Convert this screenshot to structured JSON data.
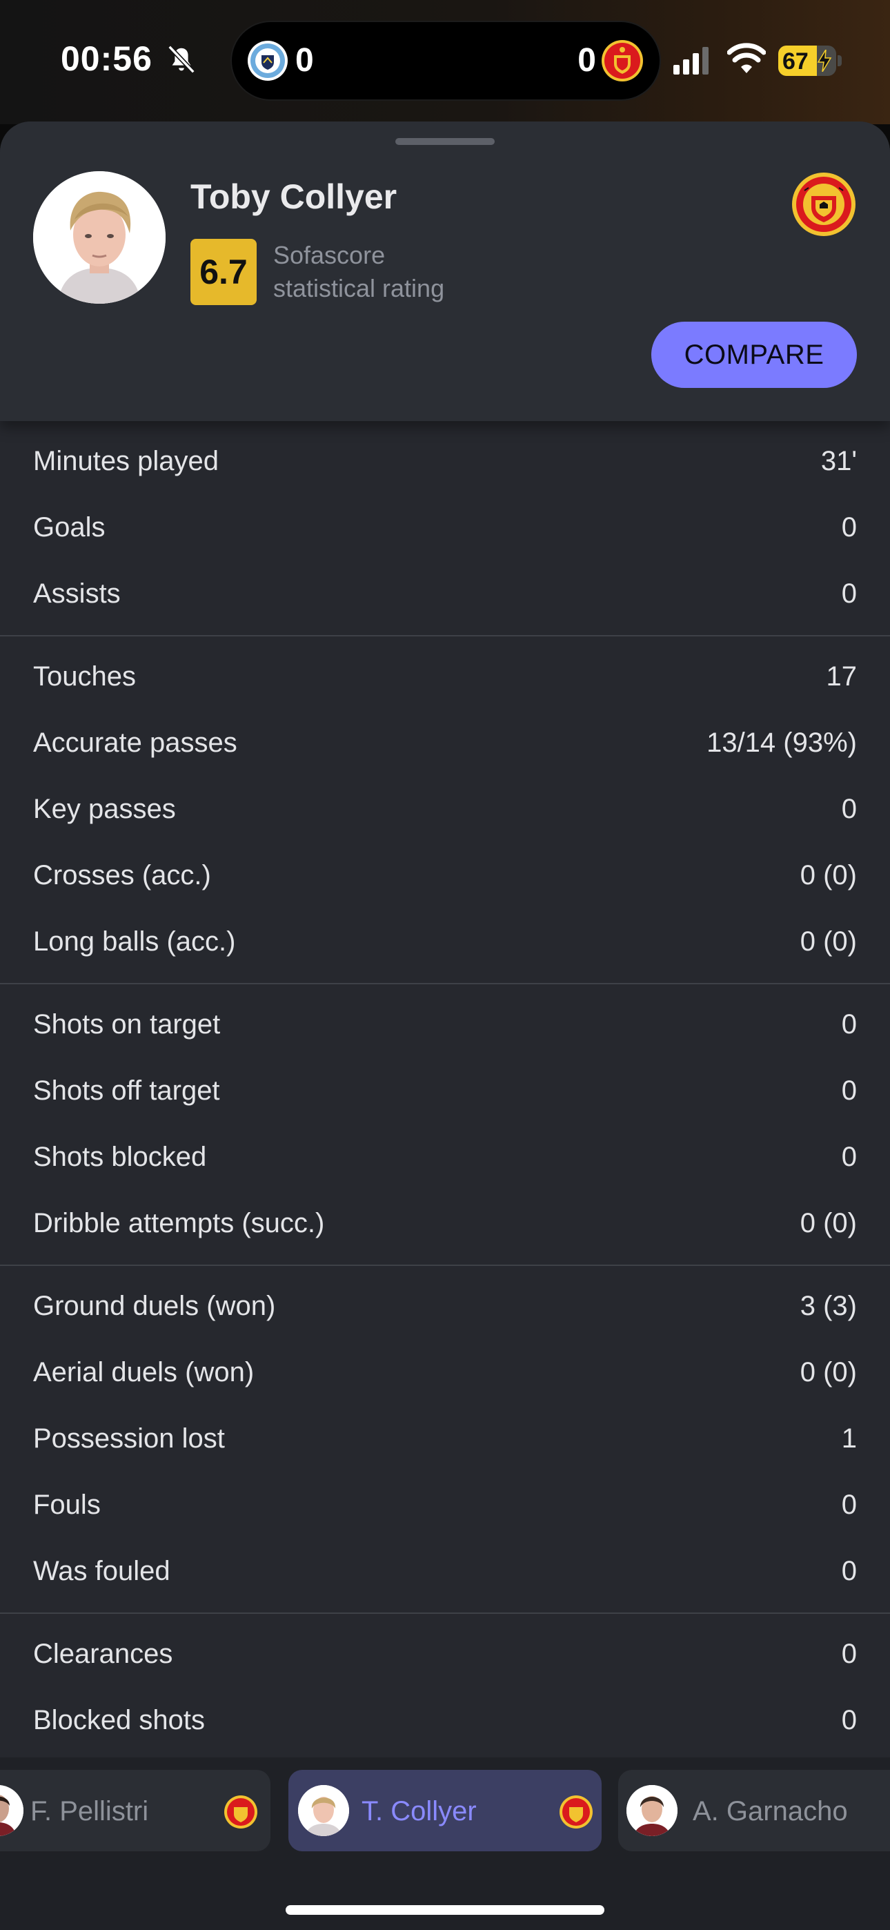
{
  "status_bar": {
    "time": "00:56",
    "silent_icon": "bell-slash-icon",
    "live_activity": {
      "home_score": "0",
      "away_score": "0",
      "home_crest": "man-city-crest",
      "away_crest": "man-united-crest"
    },
    "battery": {
      "level_text": "67",
      "level_fraction": 0.67,
      "charging": true
    },
    "icons": [
      "signal-icon",
      "wifi-icon",
      "battery-icon"
    ]
  },
  "player": {
    "name": "Toby Collyer",
    "rating": "6.7",
    "rating_caption_line1": "Sofascore",
    "rating_caption_line2": "statistical rating",
    "club_crest": "man-united-crest",
    "compare_label": "COMPARE",
    "rating_color": "#e6b92b"
  },
  "stat_groups": [
    {
      "rows": [
        {
          "label": "Minutes played",
          "value": "31'"
        },
        {
          "label": "Goals",
          "value": "0"
        },
        {
          "label": "Assists",
          "value": "0"
        }
      ]
    },
    {
      "rows": [
        {
          "label": "Touches",
          "value": "17"
        },
        {
          "label": "Accurate passes",
          "value": "13/14 (93%)"
        },
        {
          "label": "Key passes",
          "value": "0"
        },
        {
          "label": "Crosses (acc.)",
          "value": "0 (0)"
        },
        {
          "label": "Long balls (acc.)",
          "value": "0 (0)"
        }
      ]
    },
    {
      "rows": [
        {
          "label": "Shots on target",
          "value": "0"
        },
        {
          "label": "Shots off target",
          "value": "0"
        },
        {
          "label": "Shots blocked",
          "value": "0"
        },
        {
          "label": "Dribble attempts (succ.)",
          "value": "0 (0)"
        }
      ]
    },
    {
      "rows": [
        {
          "label": "Ground duels (won)",
          "value": "3 (3)"
        },
        {
          "label": "Aerial duels (won)",
          "value": "0 (0)"
        },
        {
          "label": "Possession lost",
          "value": "1"
        },
        {
          "label": "Fouls",
          "value": "0"
        },
        {
          "label": "Was fouled",
          "value": "0"
        }
      ]
    },
    {
      "rows": [
        {
          "label": "Clearances",
          "value": "0"
        },
        {
          "label": "Blocked shots",
          "value": "0"
        }
      ]
    }
  ],
  "carousel": {
    "players": [
      {
        "name": "F. Pellistri",
        "active": false
      },
      {
        "name": "T. Collyer",
        "active": true
      },
      {
        "name": "A. Garnacho",
        "active": false
      }
    ]
  },
  "colors": {
    "accent": "#7b7bff",
    "sheet_background": "#26282e",
    "header_background": "#2b2e34",
    "rating_badge": "#e6b92b"
  }
}
